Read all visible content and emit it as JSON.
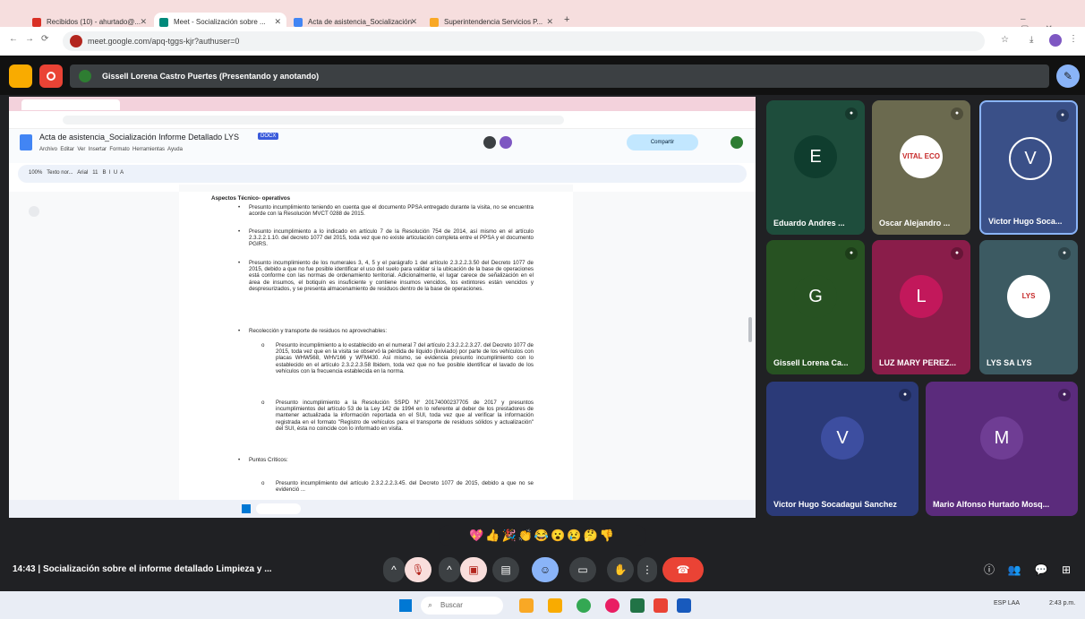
{
  "browser": {
    "tabs": [
      {
        "label": "Recibidos (10) - ahurtado@...",
        "color": "#d93025"
      },
      {
        "label": "Meet - Socialización sobre ...",
        "color": "#00897b"
      },
      {
        "label": "Acta de asistencia_Socialización",
        "color": "#4285f4"
      },
      {
        "label": "Superintendencia Servicios P...",
        "color": "#f9a825"
      }
    ],
    "url": "meet.google.com/apq-tggs-kjr?authuser=0"
  },
  "meet": {
    "presenter_label": "Gissell Lorena Castro Puertes (Presentando y anotando)",
    "meeting_time": "14:43",
    "meeting_title": "Socialización sobre el informe detallado Limpieza y ...",
    "reactions": "💖👍🎉👏😂😮😢🤔👎",
    "colors": {
      "end_call": "#ea4335",
      "muted": "#f9dedc",
      "accent": "#8ab4f8"
    }
  },
  "doc": {
    "title": "Acta de asistencia_Socialización Informe Detallado LYS",
    "badge": "DOCX",
    "menu": "Archivo  Editar  Ver  Insertar  Formato  Herramientas  Ayuda",
    "share_label": "Compartir",
    "toolbar": "100%   Texto nor...   Arial   11   B  I  U  A",
    "heading": "Aspectos Técnico- operativos",
    "paragraphs": [
      "Presunto incumplimiento teniendo en cuenta que el documento PPSA entregado durante la visita, no se encuentra acorde con la Resolución MVCT 0288 de 2015.",
      "Presunto incumplimiento a lo indicado en artículo 7 de la Resolución 754 de 2014, así mismo en el artículo 2.3.2.2.1.10. del decreto 1077 del 2015, toda vez que no existe articulación completa entre el PPSA y el documento PGIRS.",
      "Presunto incumplimiento de los numerales 3, 4, 5 y el parágrafo 1 del artículo 2.3.2.2.3.50 del Decreto 1077 de 2015, debido a que no fue posible identificar el uso del suelo para validar si la ubicación de la base de operaciones está conforme con las normas de ordenamiento territorial. Adicionalmente, el lugar carece de señalización en el área de insumos, el botiquín es insuficiente y contiene insumos vencidos, los extintores están vencidos y despresurizados, y se presenta almacenamiento de residuos dentro de la base de operaciones.",
      "Recolección y transporte de residuos no aprovechables:"
    ],
    "sub_paragraphs": [
      "Presunto incumplimiento a lo establecido en el numeral 7 del artículo 2.3.2.2.2.3.27. del Decreto 1077 de 2015, toda vez que en la visita se observó la pérdida de líquido (lixiviado) por parte de los vehículos con placas WHW568, WHV166 y WFM430. Así mismo, se evidencia presunto incumplimiento con lo establecido en el artículo 2.3.2.2.3.58 Ibidem, toda vez que no fue posible identificar el lavado de los vehículos con la frecuencia establecida en la norma.",
      "Presunto incumplimiento a la Resolución SSPD N° 20174000237705 de 2017 y presuntos incumplimientos del artículo 53 de la Ley 142 de 1994 en lo referente al deber de los prestadores de mantener actualizada la información reportada en el SUI, toda vez que al verificar la información registrada en el formato \"Registro de vehículos para el transporte de residuos sólidos y actualización\" del SUI, ésta no coincide con lo informado en visita."
    ],
    "critical_heading": "Puntos Críticos:",
    "critical_item": "Presunto incumplimiento del artículo 2.3.2.2.2.3.45. del Decreto 1077 de 2015, debido a que no se evidenció ..."
  },
  "participants": [
    {
      "name": "Eduardo Andres ...",
      "initial": "E",
      "bg": "#1e4d3c",
      "avatar": "#0f3d2e"
    },
    {
      "name": "Oscar Alejandro ...",
      "initial": "",
      "bg": "#6b6a4f",
      "avatar": "#ffffff",
      "logo": "VITAL ECO"
    },
    {
      "name": "Victor Hugo Soca...",
      "initial": "V",
      "bg": "#3a5088",
      "avatar": "#3a5088"
    },
    {
      "name": "Gissell Lorena Ca...",
      "initial": "G",
      "bg": "#275222",
      "avatar": "#275222"
    },
    {
      "name": "LUZ MARY PEREZ...",
      "initial": "L",
      "bg": "#8a1d4a",
      "avatar": "#c2185b"
    },
    {
      "name": "LYS SA LYS",
      "initial": "",
      "bg": "#3c5a62",
      "avatar": "#ffffff",
      "logo": "LYS"
    },
    {
      "name": "Victor Hugo Socadagui Sanchez",
      "initial": "V",
      "bg": "#2b3a78",
      "avatar": "#3d4ea0"
    },
    {
      "name": "Mario Alfonso Hurtado Mosq...",
      "initial": "M",
      "bg": "#5b2b7c",
      "avatar": "#6f3d94"
    }
  ],
  "taskbar": {
    "search": "Buscar",
    "lang": "ESP LAA",
    "time": "2:43 p.m."
  }
}
